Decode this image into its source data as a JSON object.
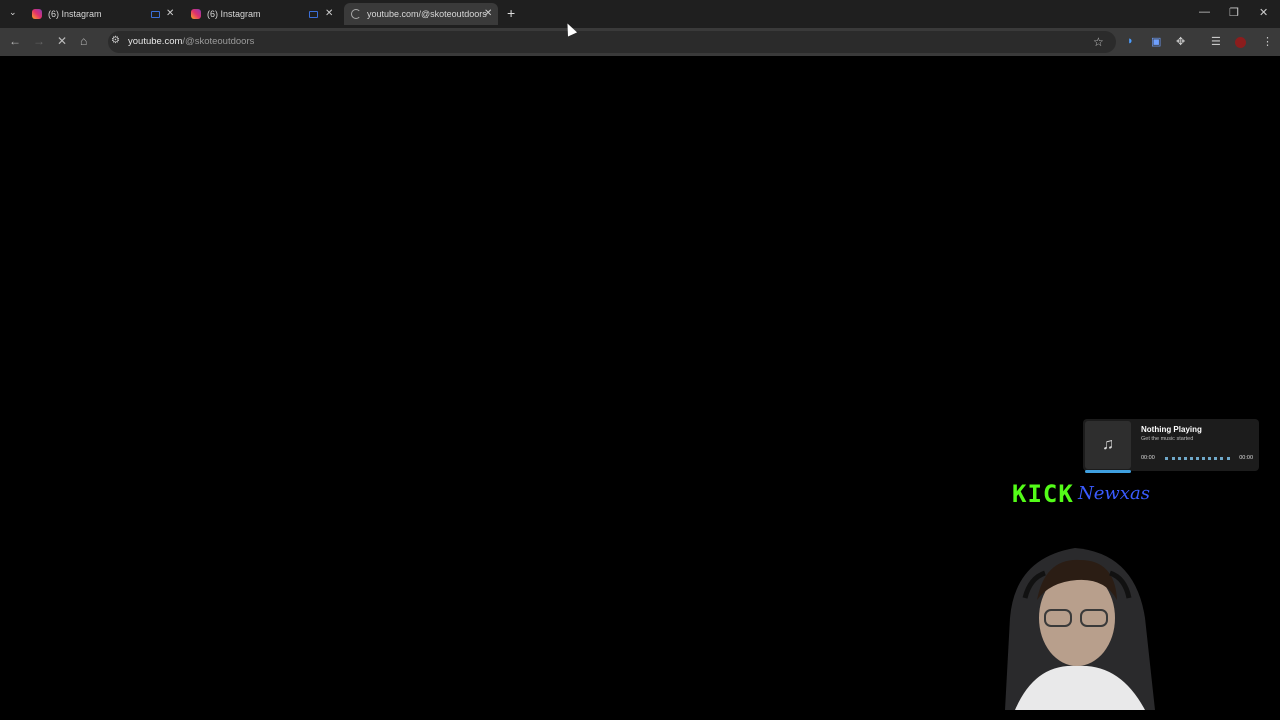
{
  "tabs": [
    {
      "title": "(6) Instagram",
      "favicon": "instagram-icon"
    },
    {
      "title": "(6) Instagram",
      "favicon": "instagram-icon"
    },
    {
      "title": "youtube.com/@skoteoutdoors",
      "favicon": "loading-icon"
    }
  ],
  "new_tab_label": "+",
  "address": {
    "host": "youtube.com",
    "path": "/@skoteoutdoors"
  },
  "music_widget": {
    "title": "Nothing Playing",
    "subtitle": "Get the music started",
    "time_start": "00:00",
    "time_end": "00:00",
    "icon": "music-note-icon"
  },
  "overlay": {
    "brand": "KICK",
    "streamer": "Newxas",
    "brand_color": "#53fc18",
    "streamer_color": "#3a5bff"
  }
}
